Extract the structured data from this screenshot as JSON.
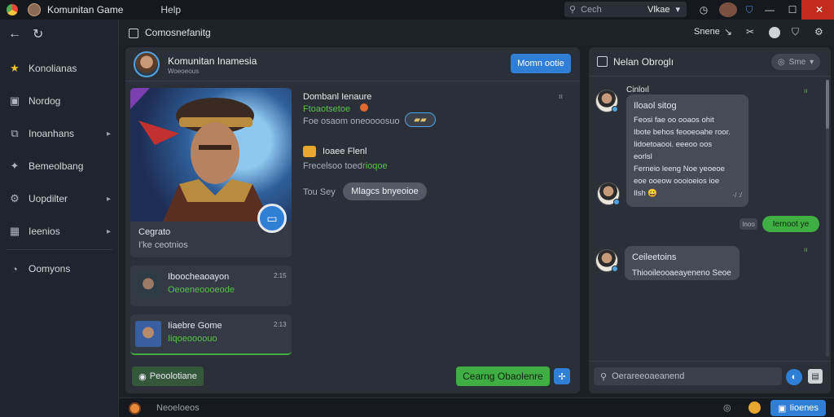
{
  "titlebar": {
    "title": "Komunitan Game",
    "menu_help": "Help",
    "search_placeholder": "Cech",
    "search_value": "Vlkae"
  },
  "sidebar": {
    "items": [
      {
        "label": "Konolianas",
        "icon": "star-icon"
      },
      {
        "label": "Nordog",
        "icon": "image-icon"
      },
      {
        "label": "Inoanhans",
        "icon": "layers-icon"
      },
      {
        "label": "Bemeolbang",
        "icon": "pin-icon"
      },
      {
        "label": "Uopdilter",
        "icon": "gear-icon"
      },
      {
        "label": "Ieenios",
        "icon": "grid-icon"
      },
      {
        "label": "Oomyons",
        "icon": "chat-icon"
      }
    ]
  },
  "content_header": {
    "title": "Comosnefanitg",
    "right_label": "Snene"
  },
  "main": {
    "group_name": "Komunitan Inamesia",
    "group_sub": "Woeoeous",
    "action_button": "Momn ootie",
    "header_count": "ıı",
    "featured": {
      "title": "Cegrato",
      "subtitle": "I'ke ceotnios"
    },
    "info1_title": "Dombanl Ienaure",
    "info1_green": "Ftoaotsetoe",
    "info1_muted": "Foe osaom oneoooosuo",
    "info2_title": "Ioaee Flenl",
    "info2_muted": "Frecelsoo toeo",
    "info2_green": "Irioqoe",
    "chip_label": "Tou Sey",
    "chip_text": "Mlagcs bnyeoioe",
    "list": [
      {
        "title": "Iboocheaoayon",
        "sub": "Oeoeneoooeode",
        "time": "2:15"
      },
      {
        "title": "Iiaebre Gome",
        "sub": "Iiqoeoooouo",
        "time": "2:13"
      }
    ],
    "footer_left_button": "Peoolotiane",
    "footer_green_button": "Cearng Obaolenre"
  },
  "chat": {
    "header_title": "Nelan Obroglı",
    "header_chip": "Sme",
    "messages": [
      {
        "author": "Cinloıl",
        "title": "Iloaol sitog",
        "lines": [
          "Feosi fae oo ooaos ohit",
          "Ibote behos feooeoahe roor.",
          "Iidoetoaooi. eeeoo oos",
          "eorlsl",
          "Ferneio leeng Noe yeoeoe",
          "eoe ooeow oooioeios ioe",
          "Ilsh 😀"
        ],
        "time": "·/ :/"
      },
      {
        "own_label": "Iernoot ye",
        "small": "Inoo"
      },
      {
        "author": "Ceileetoins",
        "text": "Thiooileooaeayeneno Seoe"
      }
    ],
    "input_placeholder": "Oerareeoaeanend"
  },
  "bottombar": {
    "placeholder": "Neoeloeos",
    "button": "Iioenes"
  }
}
